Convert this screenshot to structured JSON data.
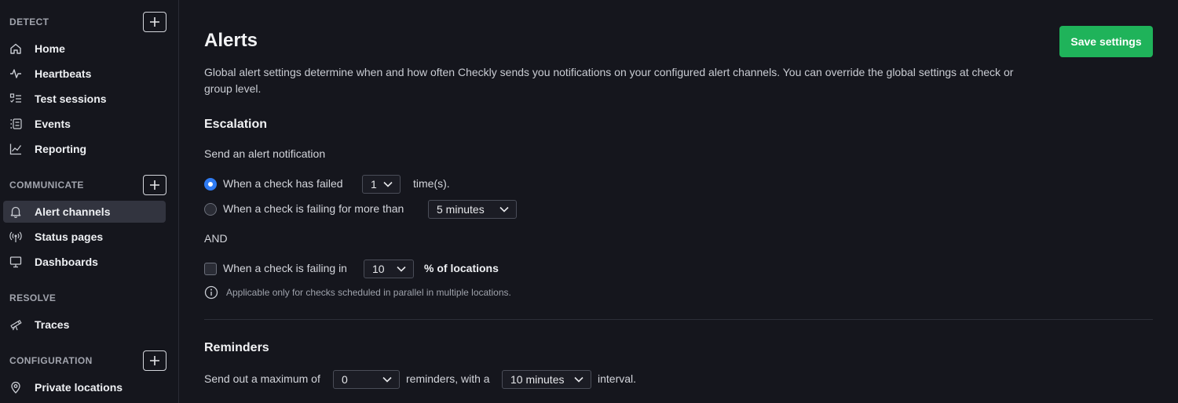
{
  "sidebar": {
    "sections": [
      {
        "title": "DETECT",
        "has_add": true
      },
      {
        "title": "COMMUNICATE",
        "has_add": true
      },
      {
        "title": "RESOLVE",
        "has_add": false
      },
      {
        "title": "CONFIGURATION",
        "has_add": true
      }
    ],
    "items": [
      {
        "label": "Home",
        "icon": "home-icon"
      },
      {
        "label": "Heartbeats",
        "icon": "pulse-icon"
      },
      {
        "label": "Test sessions",
        "icon": "list-check-icon"
      },
      {
        "label": "Events",
        "icon": "list-icon"
      },
      {
        "label": "Reporting",
        "icon": "chart-icon"
      },
      {
        "label": "Alert channels",
        "icon": "bell-icon",
        "active": true
      },
      {
        "label": "Status pages",
        "icon": "broadcast-icon"
      },
      {
        "label": "Dashboards",
        "icon": "monitor-icon"
      },
      {
        "label": "Traces",
        "icon": "telescope-icon"
      },
      {
        "label": "Private locations",
        "icon": "location-pin-icon"
      }
    ]
  },
  "main": {
    "title": "Alerts",
    "save_label": "Save settings",
    "description": "Global alert settings determine when and how often Checkly sends you notifications on your configured alert channels. You can override the global settings at check or group level.",
    "escalation": {
      "heading": "Escalation",
      "intro": "Send an alert notification",
      "option1_label": "When a check has failed",
      "option1_value": "1",
      "option1_suffix": "time(s).",
      "option2_label": "When a check is failing for more than",
      "option2_value": "5 minutes",
      "and_label": "AND",
      "locations_label": "When a check is failing in",
      "locations_value": "10",
      "locations_suffix": "% of locations",
      "hint": "Applicable only for checks scheduled in parallel in multiple locations."
    },
    "reminders": {
      "heading": "Reminders",
      "prefix": "Send out a maximum of",
      "count_value": "0",
      "middle": "reminders, with a",
      "interval_value": "10 minutes",
      "suffix": "interval."
    }
  },
  "colors": {
    "background": "#15161d",
    "accent_green": "#1fb35a",
    "radio_blue": "#2f7bf2",
    "active_item": "#32343f"
  }
}
